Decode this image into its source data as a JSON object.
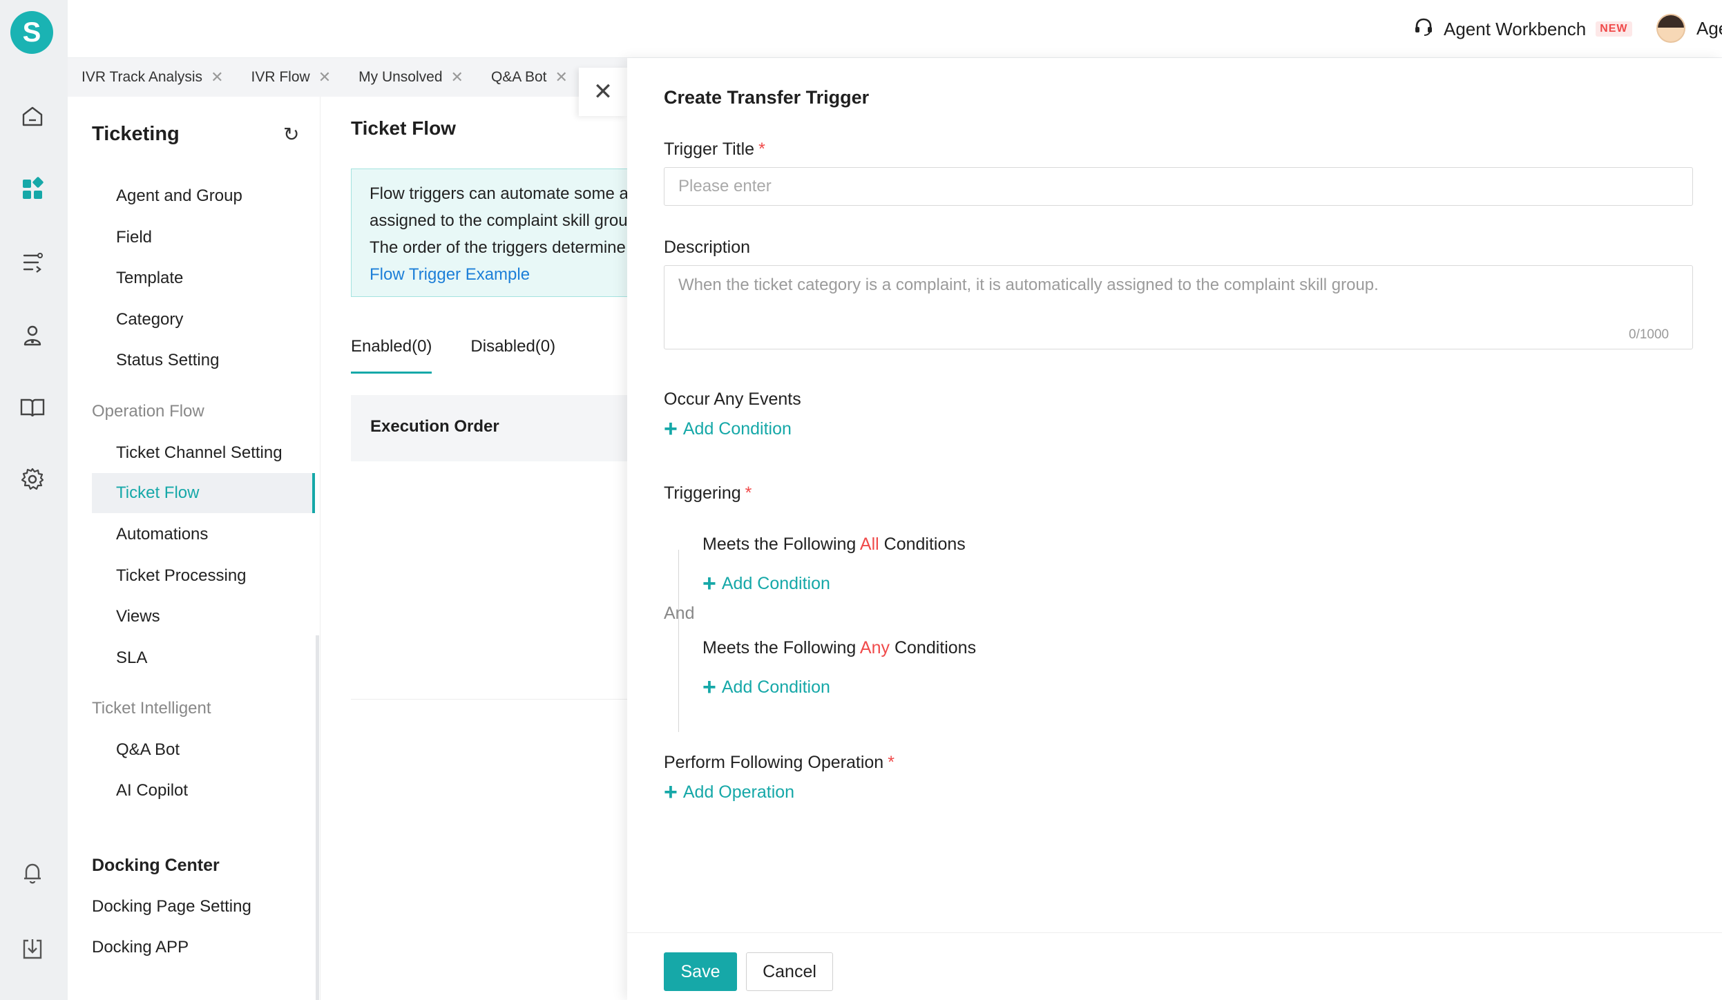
{
  "app": {
    "logo_letter": "S",
    "accent": "#16a8a8"
  },
  "rail": {
    "icons": [
      "home-icon",
      "apps-icon",
      "flow-icon",
      "user-icon",
      "book-icon",
      "gear-icon",
      "bell-icon",
      "download-icon"
    ]
  },
  "topbar": {
    "workbench_label": "Agent Workbench",
    "workbench_badge": "NEW",
    "user_name": "Agent"
  },
  "tabs": [
    {
      "label": "IVR Track Analysis"
    },
    {
      "label": "IVR Flow"
    },
    {
      "label": "My Unsolved"
    },
    {
      "label": "Q&A Bot"
    }
  ],
  "sidebar": {
    "title": "Ticketing",
    "items_top": [
      "Agent and Group",
      "Field",
      "Template",
      "Category",
      "Status Setting"
    ],
    "group_operation": "Operation Flow",
    "items_operation": [
      "Ticket Channel Setting",
      "Ticket Flow",
      "Automations",
      "Ticket Processing",
      "Views",
      "SLA"
    ],
    "group_intelligent": "Ticket Intelligent",
    "items_intelligent": [
      "Q&A Bot",
      "AI Copilot"
    ],
    "docking_title": "Docking Center",
    "docking_items": [
      "Docking Page Setting",
      "Docking APP"
    ]
  },
  "main": {
    "title": "Ticket Flow",
    "info_line1": "Flow triggers can automate some a",
    "info_line2": "assigned to the complaint skill grou",
    "info_line3": "The order of the triggers determine",
    "info_link": "Flow Trigger Example",
    "tab_enabled": "Enabled(0)",
    "tab_disabled": "Disabled(0)",
    "table_header": "Execution Order"
  },
  "drawer": {
    "title": "Create Transfer Trigger",
    "trigger_title_label": "Trigger Title",
    "trigger_title_placeholder": "Please enter",
    "description_label": "Description",
    "description_placeholder": "When the ticket category is a complaint, it is automatically assigned to the complaint skill group.",
    "description_counter": "0/1000",
    "events_label": "Occur Any Events",
    "add_condition": "Add Condition",
    "triggering_label": "Triggering",
    "meets_prefix": "Meets the Following",
    "all_word": "All",
    "any_word": "Any",
    "conditions_suffix": "Conditions",
    "and_label": "And",
    "operation_label": "Perform Following Operation",
    "add_operation": "Add Operation",
    "required_mark": "*",
    "save_label": "Save",
    "cancel_label": "Cancel"
  }
}
